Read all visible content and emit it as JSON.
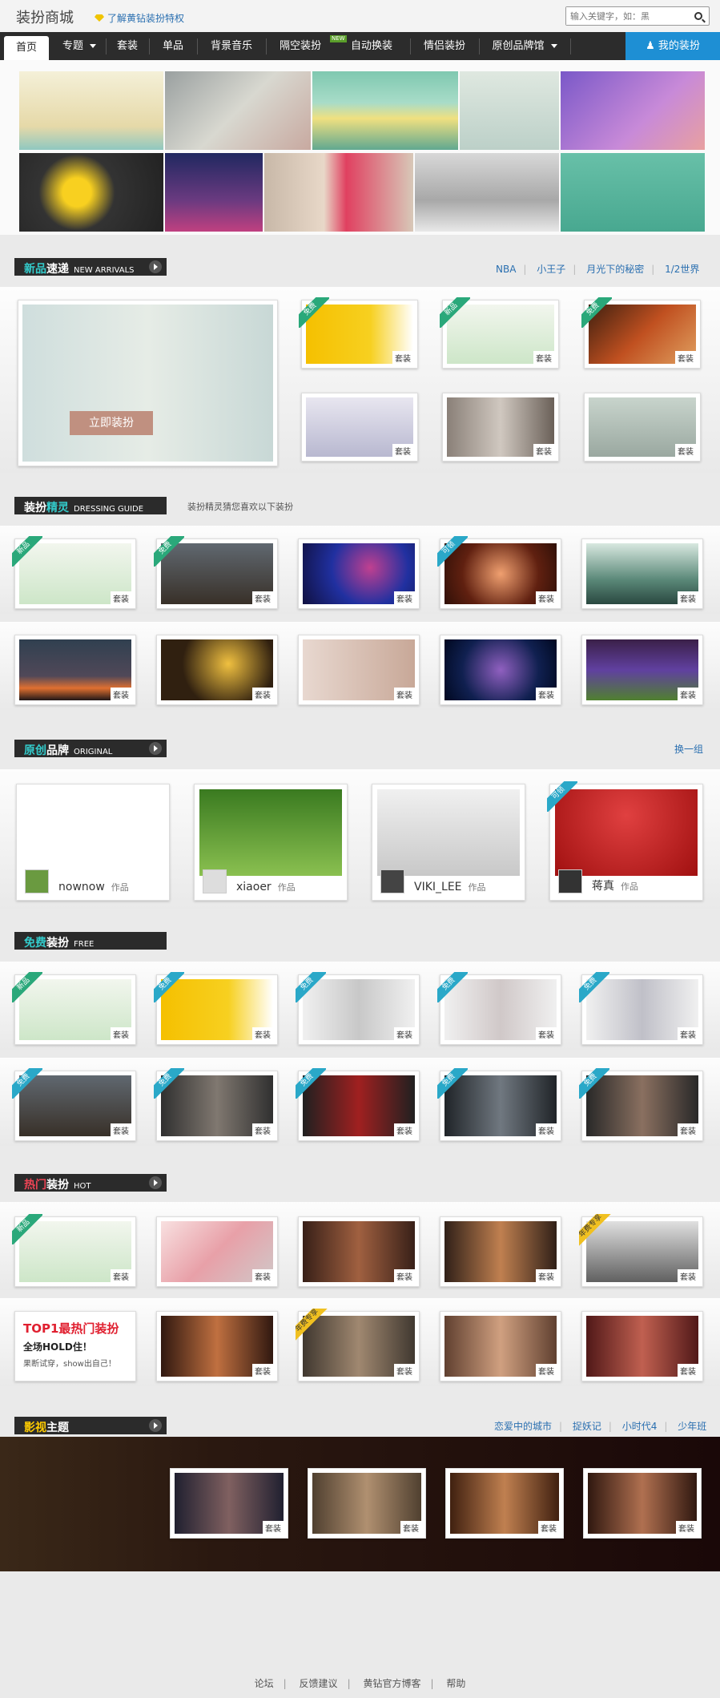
{
  "header": {
    "site_title": "装扮商城",
    "vip_link": "了解黄钻装扮特权",
    "search_placeholder": "输入关键字，如：黑"
  },
  "nav": {
    "items": [
      "首页",
      "专题",
      "套装",
      "单品",
      "背景音乐",
      "隔空装扮",
      "自动换装",
      "情侣装扮",
      "原创品牌馆"
    ],
    "new_badge": "NEW",
    "my_button": "我的装扮"
  },
  "sections": {
    "new_arrivals": {
      "title_a": "新品",
      "title_b": "速递",
      "en": "NEW ARRIVALS",
      "links": [
        "NBA",
        "小王子",
        "月光下的秘密",
        "1/2世界"
      ],
      "feature_btn": "立即装扮"
    },
    "dressing_guide": {
      "title_a": "装扮",
      "title_b": "精灵",
      "en": "DRESSING GUIDE",
      "subtitle": "装扮精灵猜您喜欢以下装扮"
    },
    "original": {
      "title_a": "原创",
      "title_b": "品牌",
      "en": "ORIGINAL",
      "link": "换一组",
      "brands": [
        {
          "name": "nownow",
          "tag": "作品"
        },
        {
          "name": "xiaoer",
          "tag": "作品"
        },
        {
          "name": "VIKI_LEE",
          "tag": "作品"
        },
        {
          "name": "蒋真",
          "tag": "作品"
        }
      ]
    },
    "free": {
      "title_a": "免费",
      "title_b": "装扮",
      "en": "FREE"
    },
    "hot": {
      "title_a": "热门",
      "title_b": "装扮",
      "en": "HOT",
      "promo_title": "TOP1最热门装扮",
      "promo_line": "全场HOLD住！",
      "promo_sub": "果断试穿，show出自己！"
    },
    "movie": {
      "title_a": "影视",
      "title_b": "主题",
      "links": [
        "恋爱中的城市",
        "捉妖记",
        "小时代4",
        "少年班"
      ]
    }
  },
  "labels": {
    "suit": "套装",
    "free": "免费",
    "new": "新品",
    "try": "可领",
    "year_vip": "年费专享"
  },
  "footer": {
    "links": [
      "论坛",
      "反馈建议",
      "黄钻官方博客",
      "帮助"
    ]
  },
  "colors": {
    "nav_bg": "#2c2c2c",
    "accent_blue": "#1e8fd4",
    "ribbon_green": "#2aa87a",
    "ribbon_blue": "#2aa8c8"
  }
}
